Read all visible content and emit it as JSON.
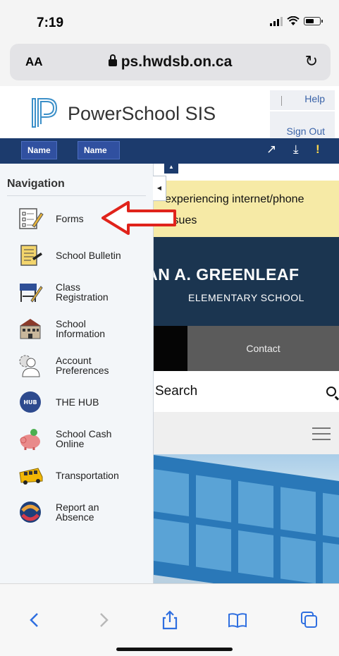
{
  "status": {
    "time": "7:19"
  },
  "browser": {
    "text_size_label": "AA",
    "url": "ps.hwdsb.on.ca"
  },
  "header": {
    "title": "PowerSchool SIS",
    "help_label": "Help",
    "signout_label": "Sign Out"
  },
  "navbar": {
    "name_tab_1": "Name",
    "name_tab_2": "Name"
  },
  "navigation": {
    "title": "Navigation",
    "items": [
      {
        "label": "Forms",
        "icon": "forms-icon"
      },
      {
        "label": "School Bulletin",
        "icon": "bulletin-icon"
      },
      {
        "label": "Class\nRegistration",
        "icon": "class-registration-icon"
      },
      {
        "label": "School\nInformation",
        "icon": "school-building-icon"
      },
      {
        "label": "Account\nPreferences",
        "icon": "account-preferences-icon"
      },
      {
        "label": "THE HUB",
        "icon": "hub-icon"
      },
      {
        "label": "School Cash\nOnline",
        "icon": "piggy-bank-icon"
      },
      {
        "label": "Transportation",
        "icon": "school-bus-icon"
      },
      {
        "label": "Report an\nAbsence",
        "icon": "report-absence-icon"
      }
    ]
  },
  "site": {
    "alert_line1": "experiencing internet/phone",
    "alert_line2": "issues",
    "school_name": "LLAN A. GREENLEAF",
    "school_sub": "ELEMENTARY SCHOOL",
    "contact_label": "Contact",
    "search_label": "Search"
  },
  "colors": {
    "navbar": "#1c3b6d",
    "annotation_arrow": "#e0231b",
    "alert_bg": "#f6eaa6",
    "banner_bg": "#1b3550"
  }
}
